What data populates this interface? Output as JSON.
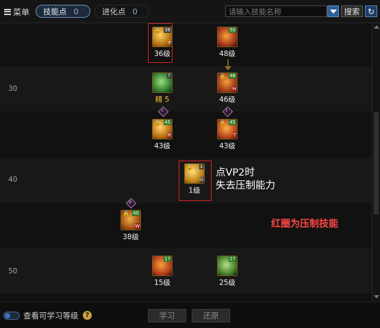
{
  "toolbar": {
    "menu_label": "菜单",
    "skill_points_label": "技能点",
    "skill_points_value": "0",
    "evolution_points_label": "进化点",
    "evolution_points_value": "0",
    "search_placeholder": "请输入技能名称",
    "search_button": "搜索"
  },
  "tree": {
    "level_markers": [
      "30",
      "40",
      "50"
    ],
    "skills": [
      {
        "id": "s1",
        "level_text": "36级",
        "rank": "38",
        "tag": "F",
        "highlighted": true,
        "color": "#c98d1a"
      },
      {
        "id": "s2",
        "level_text": "48级",
        "rank": "50",
        "tag": "",
        "highlighted": false,
        "color": "#b43b1c"
      },
      {
        "id": "s3",
        "level_text": "46级",
        "rank": "48",
        "tag": "H",
        "highlighted": false,
        "color": "#b43b1c"
      },
      {
        "id": "s4",
        "level_text": "",
        "rank": "7",
        "tag": "",
        "highlighted": false,
        "color": "#3aa24a"
      },
      {
        "id": "s5",
        "level_text": "43级",
        "rank": "45",
        "tag": "R",
        "highlighted": false,
        "color": "#d3861a"
      },
      {
        "id": "s6",
        "level_text": "43级",
        "rank": "45",
        "tag": "T",
        "highlighted": false,
        "color": "#c04a1e"
      },
      {
        "id": "s7",
        "level_text": "1级",
        "rank": "3",
        "tag": "G",
        "highlighted": true,
        "color": "#c98d1a"
      },
      {
        "id": "s8",
        "level_text": "38级",
        "rank": "40",
        "tag": "W",
        "highlighted": false,
        "color": "#b9581b"
      },
      {
        "id": "s9",
        "level_text": "15级",
        "rank": "17",
        "tag": "",
        "highlighted": false,
        "color": "#c6431c"
      },
      {
        "id": "s10",
        "level_text": "25级",
        "rank": "27",
        "tag": "",
        "highlighted": false,
        "color": "#4c8c32"
      }
    ],
    "special_label": "精",
    "special_value": "5",
    "tier_badges": [
      "I",
      "I",
      "II"
    ],
    "annotation_vp2_line1": "点VP2时",
    "annotation_vp2_line2": "失去压制能力",
    "annotation_red": "红圈为压制技能"
  },
  "bottom": {
    "toggle_label": "查看可学习等级",
    "help_icon": "?",
    "learn_button": "学习",
    "reset_button": "还原"
  },
  "colors": {
    "accent": "#2b5d9c",
    "highlight_border": "#e0251f",
    "annotation_red": "#ff4742"
  }
}
